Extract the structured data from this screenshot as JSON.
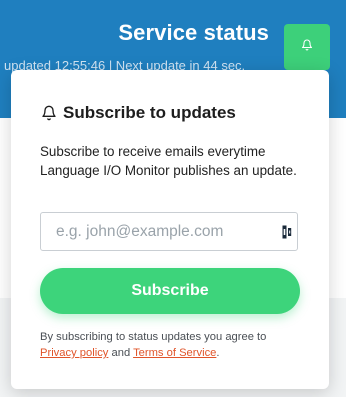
{
  "header": {
    "title": "Service status",
    "updated_text": "updated 12:55:46 | Next update in 44 sec."
  },
  "popup": {
    "title": "Subscribe to updates",
    "description": "Subscribe to receive emails everytime Language I/O Monitor publishes an update.",
    "email_placeholder": "e.g. john@example.com",
    "subscribe_label": "Subscribe",
    "legal_prefix": "By subscribing to status updates you agree to",
    "privacy_label": "Privacy policy",
    "and_text": "and",
    "terms_label": "Terms of Service",
    "period": "."
  },
  "icons": {
    "bell_button": "bell-icon",
    "title_icon": "bell-icon",
    "field_icon": "password-manager-icon"
  },
  "colors": {
    "header_blue": "#1f7fbf",
    "accent_green": "#3dd47b",
    "link_orange": "#e0542a"
  }
}
